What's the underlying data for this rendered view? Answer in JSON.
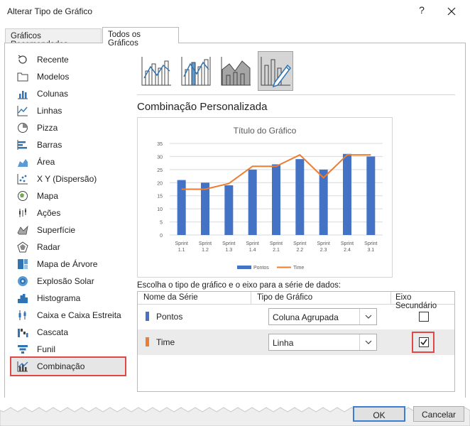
{
  "window": {
    "title": "Alterar Tipo de Gráfico",
    "help": "?"
  },
  "tabs": [
    {
      "label": "Gráficos Recomendados",
      "active": false
    },
    {
      "label": "Todos os Gráficos",
      "active": true
    }
  ],
  "categories": [
    {
      "label": "Recente",
      "icon": "recent-icon"
    },
    {
      "label": "Modelos",
      "icon": "folder-icon"
    },
    {
      "label": "Colunas",
      "icon": "column-chart-icon"
    },
    {
      "label": "Linhas",
      "icon": "line-chart-icon"
    },
    {
      "label": "Pizza",
      "icon": "pie-chart-icon"
    },
    {
      "label": "Barras",
      "icon": "bar-chart-icon"
    },
    {
      "label": "Área",
      "icon": "area-chart-icon"
    },
    {
      "label": "X Y (Dispersão)",
      "icon": "scatter-chart-icon"
    },
    {
      "label": "Mapa",
      "icon": "map-chart-icon"
    },
    {
      "label": "Ações",
      "icon": "stock-chart-icon"
    },
    {
      "label": "Superfície",
      "icon": "surface-chart-icon"
    },
    {
      "label": "Radar",
      "icon": "radar-chart-icon"
    },
    {
      "label": "Mapa de Árvore",
      "icon": "treemap-chart-icon"
    },
    {
      "label": "Explosão Solar",
      "icon": "sunburst-chart-icon"
    },
    {
      "label": "Histograma",
      "icon": "histogram-chart-icon"
    },
    {
      "label": "Caixa e Caixa Estreita",
      "icon": "box-whisker-chart-icon"
    },
    {
      "label": "Cascata",
      "icon": "waterfall-chart-icon"
    },
    {
      "label": "Funil",
      "icon": "funnel-chart-icon"
    },
    {
      "label": "Combinação",
      "icon": "combo-chart-icon",
      "selected": true
    }
  ],
  "subtypes": [
    {
      "icon": "combo-column-line-icon",
      "selected": false
    },
    {
      "icon": "combo-column-line-secondary-icon",
      "selected": false
    },
    {
      "icon": "combo-area-column-icon",
      "selected": false
    },
    {
      "icon": "combo-custom-icon",
      "selected": true
    }
  ],
  "section_title": "Combinação Personalizada",
  "chart_data": {
    "type": "bar",
    "title": "Título do Gráfico",
    "categories": [
      [
        "Sprint",
        "1.1"
      ],
      [
        "Sprint",
        "1.2"
      ],
      [
        "Sprint",
        "1.3"
      ],
      [
        "Sprint",
        "1.4"
      ],
      [
        "Sprint",
        "2.1"
      ],
      [
        "Sprint",
        "2.2"
      ],
      [
        "Sprint",
        "2.3"
      ],
      [
        "Sprint",
        "2.4"
      ],
      [
        "Sprint",
        "3.1"
      ]
    ],
    "ylim": [
      0,
      35
    ],
    "yticks": [
      "0",
      "5",
      "10",
      "15",
      "20",
      "25",
      "30",
      "35"
    ],
    "y2lim": [
      0,
      8
    ],
    "y2ticks": [
      "0",
      "1",
      "2",
      "3",
      "4",
      "5",
      "6",
      "7",
      "8"
    ],
    "grid": true,
    "legend": "bottom",
    "series": [
      {
        "name": "Pontos",
        "type": "bar",
        "axis": "primary",
        "color": "#4472C4",
        "values": [
          21,
          20,
          19,
          25,
          27,
          29,
          25,
          31,
          30
        ]
      },
      {
        "name": "Time",
        "type": "line",
        "axis": "secondary",
        "color": "#ED7D31",
        "values": [
          4,
          4,
          4.5,
          6,
          6,
          7,
          5,
          7,
          7
        ]
      }
    ]
  },
  "series_section": {
    "caption": "Escolha o tipo de gráfico e o eixo para a série de dados:",
    "headers": {
      "name": "Nome da Série",
      "type": "Tipo de Gráfico",
      "secondary": "Eixo Secundário"
    },
    "rows": [
      {
        "name": "Pontos",
        "color": "#4472C4",
        "chart_type": "Coluna Agrupada",
        "secondary_axis": false
      },
      {
        "name": "Time",
        "color": "#ED7D31",
        "chart_type": "Linha",
        "secondary_axis": true
      }
    ]
  },
  "buttons": {
    "ok": "OK",
    "cancel": "Cancelar"
  }
}
